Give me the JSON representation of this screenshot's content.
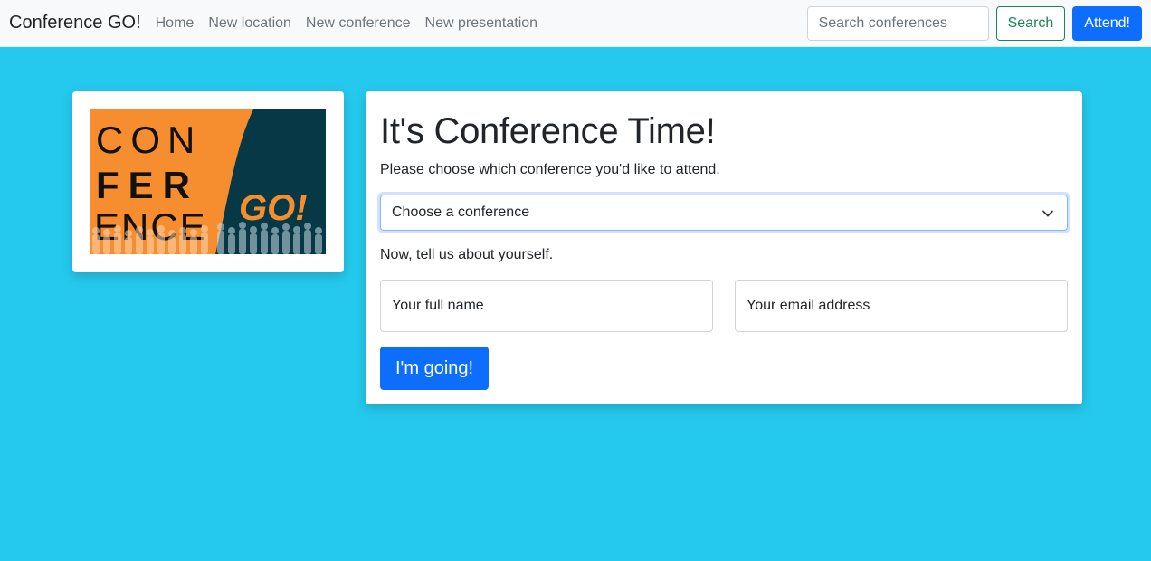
{
  "navbar": {
    "brand": "Conference GO!",
    "links": [
      "Home",
      "New location",
      "New conference",
      "New presentation"
    ],
    "search_placeholder": "Search conferences",
    "search_label": "Search",
    "attend_label": "Attend!"
  },
  "logo": {
    "line1": "CON",
    "line2": "FER",
    "line3": "ENCE",
    "go": "GO!"
  },
  "form": {
    "title": "It's Conference Time!",
    "lead": "Please choose which conference you'd like to attend.",
    "select_value": "Choose a conference",
    "about": "Now, tell us about yourself.",
    "name_placeholder": "Your full name",
    "email_placeholder": "Your email address",
    "submit_label": "I'm going!"
  },
  "colors": {
    "page_bg": "#25c9ed",
    "primary": "#0d6efd",
    "success": "#198754",
    "logo_orange": "#f68d2e",
    "logo_navy": "#073846"
  }
}
